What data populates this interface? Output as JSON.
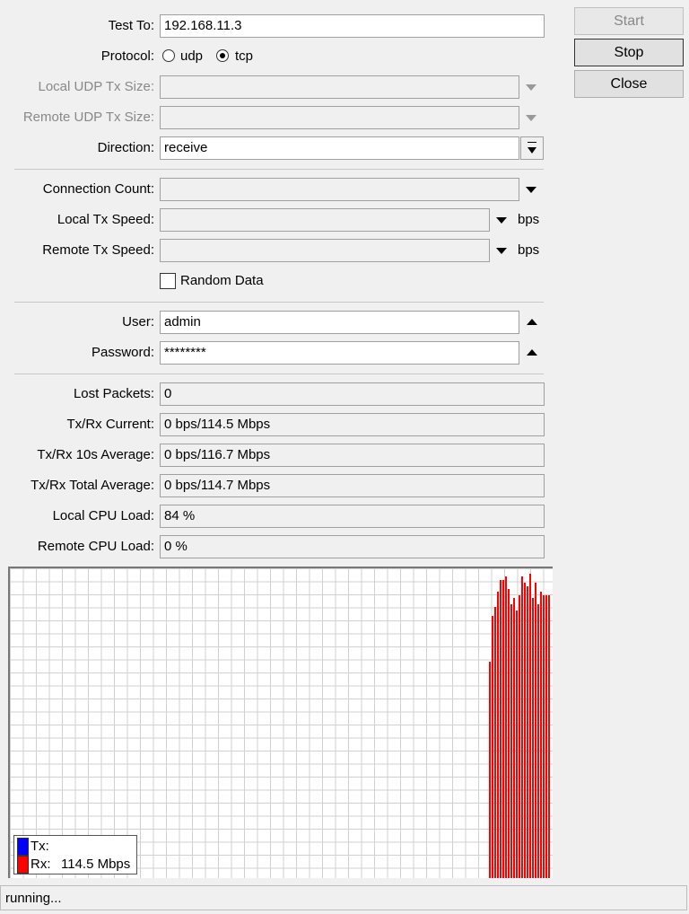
{
  "form": {
    "test_to": {
      "label": "Test To:",
      "value": "192.168.11.3"
    },
    "protocol": {
      "label": "Protocol:",
      "options": [
        "udp",
        "tcp"
      ],
      "selected": "tcp"
    },
    "local_udp_tx_size": {
      "label": "Local UDP Tx Size:",
      "value": ""
    },
    "remote_udp_tx_size": {
      "label": "Remote UDP Tx Size:",
      "value": ""
    },
    "direction": {
      "label": "Direction:",
      "value": "receive"
    },
    "connection_count": {
      "label": "Connection Count:",
      "value": ""
    },
    "local_tx_speed": {
      "label": "Local Tx Speed:",
      "value": "",
      "unit": "bps"
    },
    "remote_tx_speed": {
      "label": "Remote Tx Speed:",
      "value": "",
      "unit": "bps"
    },
    "random_data": {
      "label": "Random Data",
      "checked": false
    },
    "user": {
      "label": "User:",
      "value": "admin"
    },
    "password": {
      "label": "Password:",
      "value": "********"
    }
  },
  "stats": [
    {
      "label": "Lost Packets:",
      "value": "0"
    },
    {
      "label": "Tx/Rx Current:",
      "value": "0 bps/114.5 Mbps"
    },
    {
      "label": "Tx/Rx 10s Average:",
      "value": "0 bps/116.7 Mbps"
    },
    {
      "label": "Tx/Rx Total Average:",
      "value": "0 bps/114.7 Mbps"
    },
    {
      "label": "Local CPU Load:",
      "value": "84 %"
    },
    {
      "label": "Remote CPU Load:",
      "value": "0 %"
    }
  ],
  "buttons": {
    "start": "Start",
    "stop": "Stop",
    "close": "Close"
  },
  "chart_data": {
    "type": "bar",
    "series": [
      {
        "name": "Tx",
        "color": "#0000ff",
        "values": [
          0,
          0,
          0,
          0,
          0,
          0,
          0,
          0,
          0,
          0,
          0,
          0,
          0,
          0,
          0,
          0,
          0,
          0,
          0,
          0,
          0,
          0,
          0
        ]
      },
      {
        "name": "Rx",
        "color": "#ff0000",
        "values": [
          0.71,
          0.86,
          0.89,
          0.94,
          0.98,
          0.98,
          0.99,
          0.95,
          0.9,
          0.92,
          0.88,
          0.93,
          0.99,
          0.97,
          0.96,
          1.0,
          0.92,
          0.97,
          0.9,
          0.94,
          0.93,
          0.93,
          0.93
        ]
      }
    ],
    "value_scale": "fraction of chart height",
    "legend": {
      "tx_label": "Tx:",
      "tx_value": "",
      "rx_label": "Rx:",
      "rx_value": "114.5 Mbps",
      "placement": "bottom-left"
    }
  },
  "status": "running..."
}
